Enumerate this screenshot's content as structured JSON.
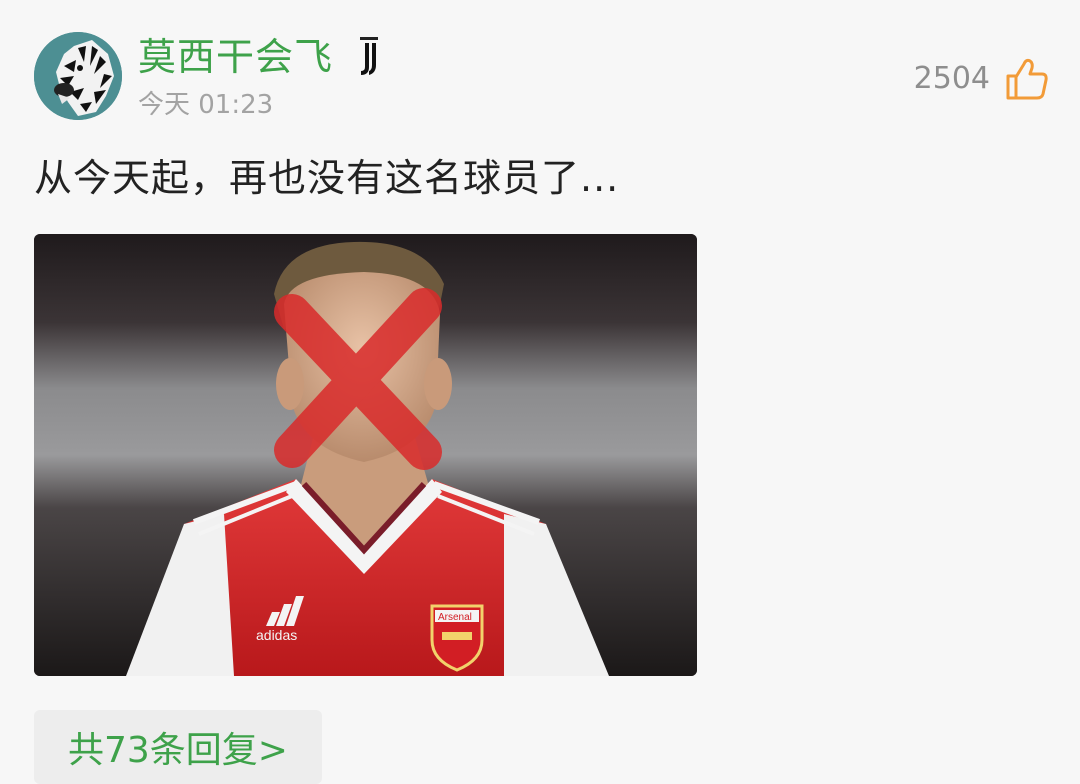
{
  "post": {
    "author": {
      "username": "莫西干会飞",
      "avatar_icon": "zebra-avatar",
      "badge_icon": "juventus-badge"
    },
    "timestamp": "今天 01:23",
    "likes": {
      "count": "2504",
      "icon": "thumbs-up-icon",
      "icon_color": "#f29b38"
    },
    "text": "从今天起，再也没有这名球员了...",
    "image": {
      "description_icon": "football-player-photo-with-red-x",
      "jersey_sponsor": "adidas",
      "crest_text": "Arsenal"
    },
    "replies": {
      "label": "共73条回复>"
    }
  },
  "colors": {
    "accent_green": "#3ea24a",
    "background": "#f7f7f7",
    "muted_text": "#a3a3a3",
    "cross_red": "#d92b2b"
  }
}
